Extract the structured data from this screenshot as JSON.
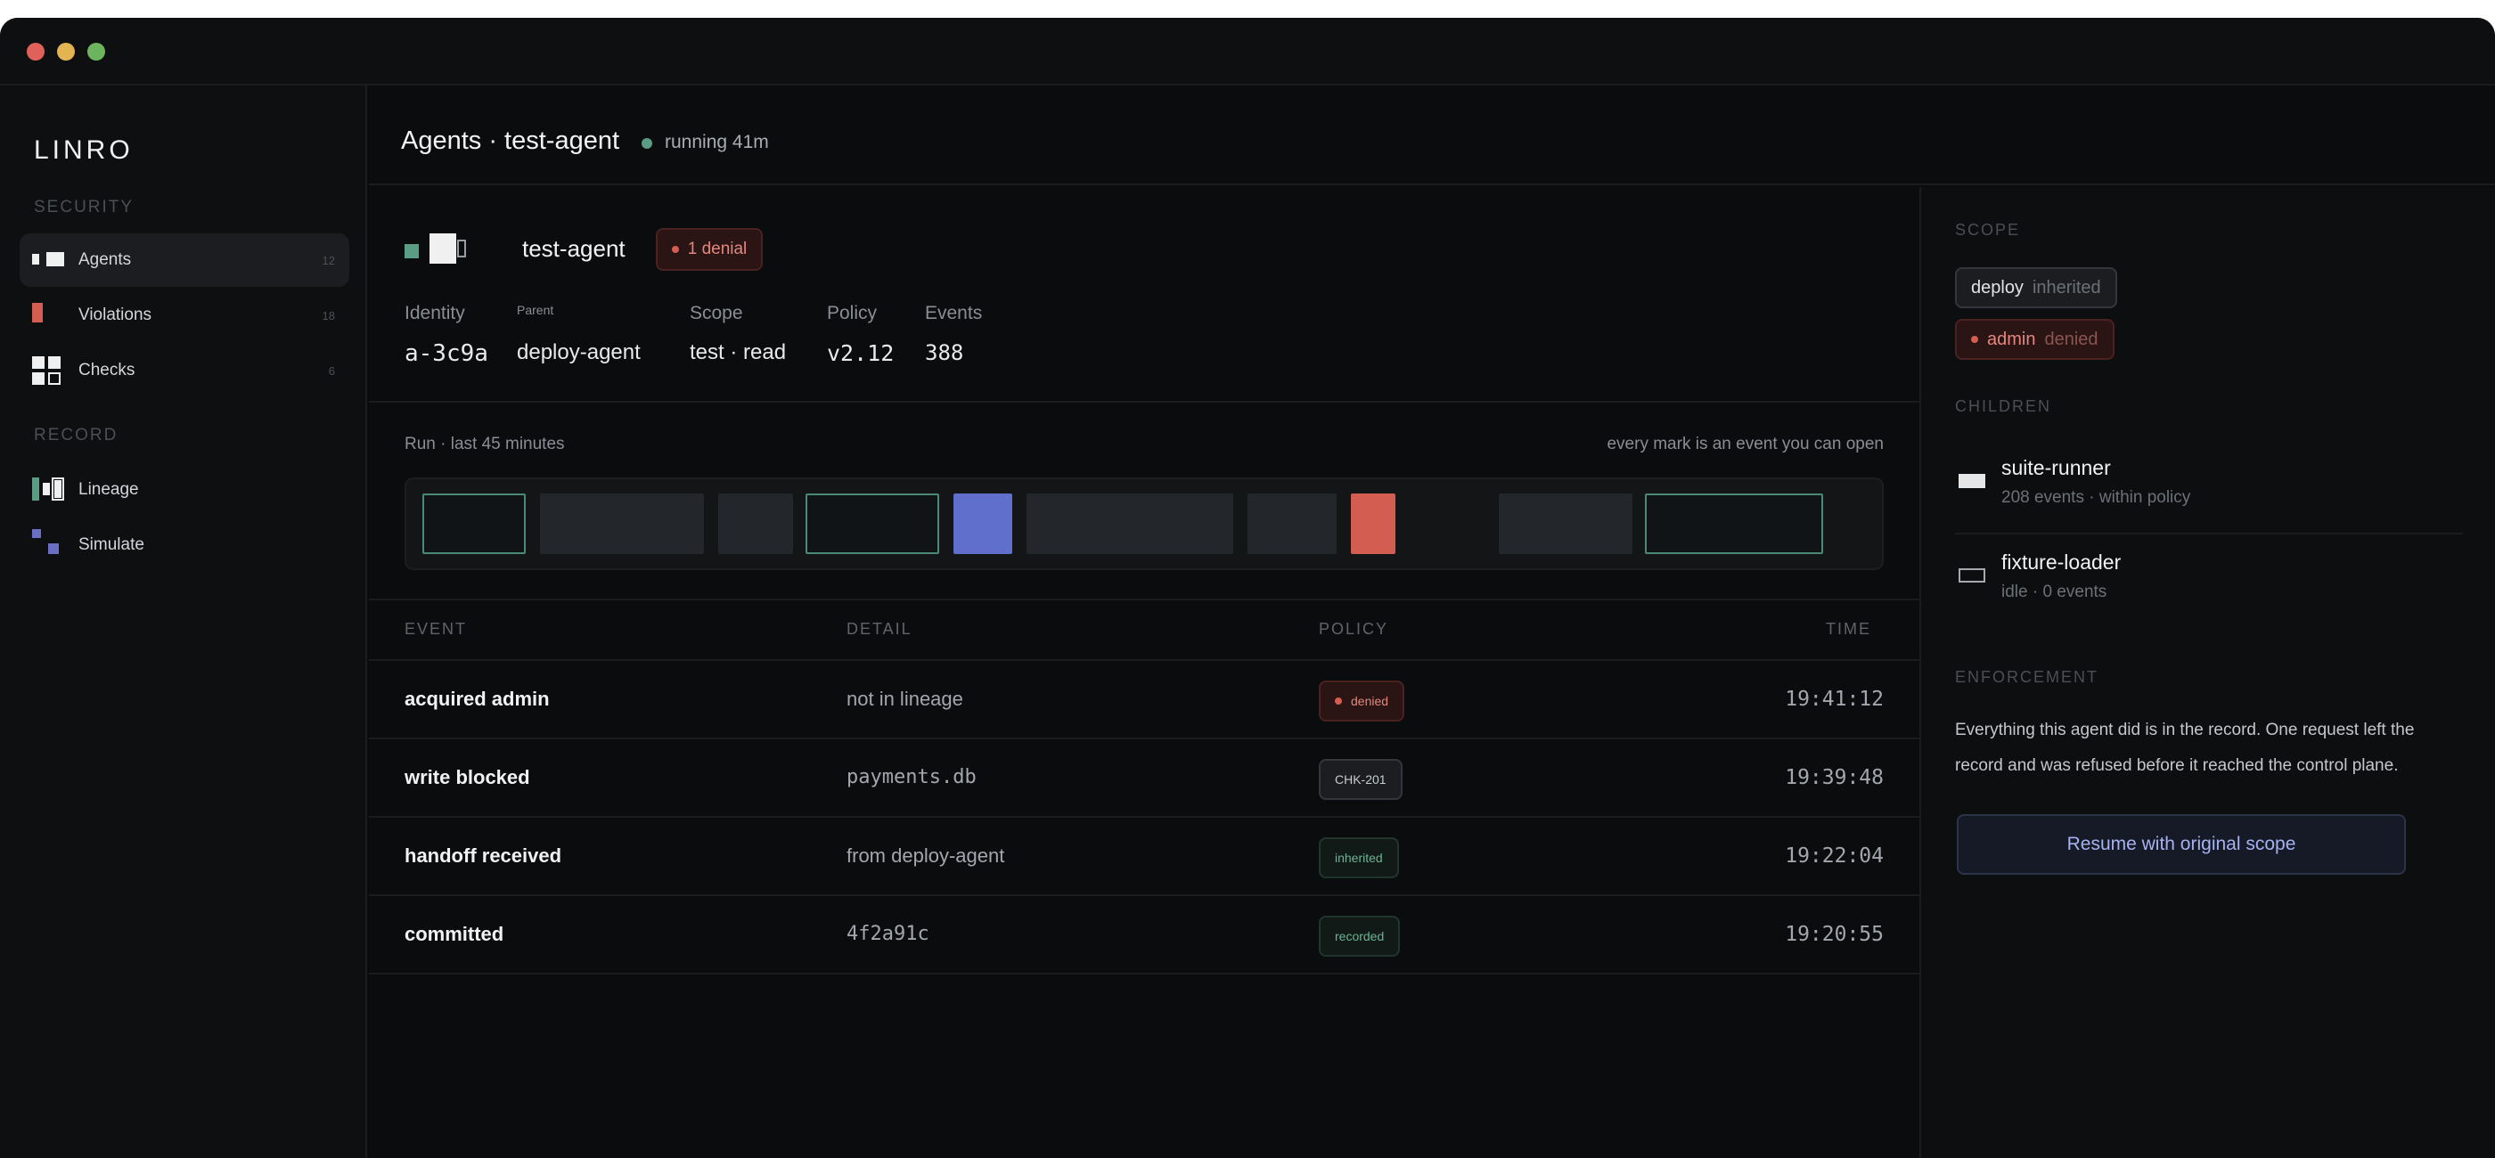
{
  "window": {
    "controls": [
      "close",
      "minimize",
      "maximize"
    ]
  },
  "sidebar": {
    "logo": "LINRO",
    "sections": [
      {
        "title": "SECURITY",
        "items": [
          {
            "label": "Agents",
            "count": "12",
            "icon": "agents-icon"
          },
          {
            "label": "Violations",
            "count": "18",
            "icon": "violations-icon"
          },
          {
            "label": "Checks",
            "count": "6",
            "icon": "checks-icon"
          }
        ]
      },
      {
        "title": "RECORD",
        "items": [
          {
            "label": "Lineage",
            "icon": "lineage-icon"
          },
          {
            "label": "Simulate",
            "icon": "simulate-icon"
          }
        ]
      }
    ]
  },
  "header": {
    "title": "Agents · test-agent",
    "status": "running 41m"
  },
  "agent": {
    "name": "test-agent",
    "denials": "1 denial",
    "meta": [
      {
        "label": "Identity",
        "value": "a-3c9a"
      },
      {
        "label": "Parent",
        "value": "deploy-agent"
      },
      {
        "label": "Scope",
        "value": "test · read"
      },
      {
        "label": "Policy",
        "value": "v2.12"
      },
      {
        "label": "Events",
        "value": "388"
      }
    ]
  },
  "run": {
    "label": "Run · last 45 minutes",
    "hint": "every mark is an event you can open",
    "marks": [
      {
        "kind": "outline-green"
      },
      {
        "kind": "gray"
      },
      {
        "kind": "gray"
      },
      {
        "kind": "outline-green"
      },
      {
        "kind": "blue"
      },
      {
        "kind": "gray"
      },
      {
        "kind": "gray"
      },
      {
        "kind": "red"
      },
      {
        "kind": "gray"
      },
      {
        "kind": "outline-green"
      }
    ]
  },
  "table": {
    "headers": {
      "event": "EVENT",
      "detail": "DETAIL",
      "policy": "POLICY",
      "time": "TIME"
    },
    "rows": [
      {
        "event": "acquired admin",
        "detail": "not in lineage",
        "policy": "denied",
        "time": "19:41:12"
      },
      {
        "event": "write blocked",
        "detail": "payments.db",
        "policy": "CHK-201",
        "time": "19:39:48"
      },
      {
        "event": "handoff received",
        "detail": "from deploy-agent",
        "policy": "inherited",
        "time": "19:22:04"
      },
      {
        "event": "committed",
        "detail": "4f2a91c",
        "policy": "recorded",
        "time": "19:20:55"
      }
    ]
  },
  "right": {
    "scope_title": "SCOPE",
    "scopes": [
      {
        "name": "deploy",
        "state": "inherited"
      },
      {
        "name": "admin",
        "state": "denied"
      }
    ],
    "children_title": "CHILDREN",
    "children": [
      {
        "name": "suite-runner",
        "sub": "208 events · within policy"
      },
      {
        "name": "fixture-loader",
        "sub": "idle · 0 events"
      }
    ],
    "enforcement_title": "ENFORCEMENT",
    "enforcement_text": "Everything this agent did is in the record. One request left the record and was refused before it reached the control plane.",
    "resume_button": "Resume with original scope"
  },
  "colors": {
    "accent_blue": "#5f6fcb",
    "deny_red": "#d45d52",
    "ok_green": "#5a9c84"
  }
}
